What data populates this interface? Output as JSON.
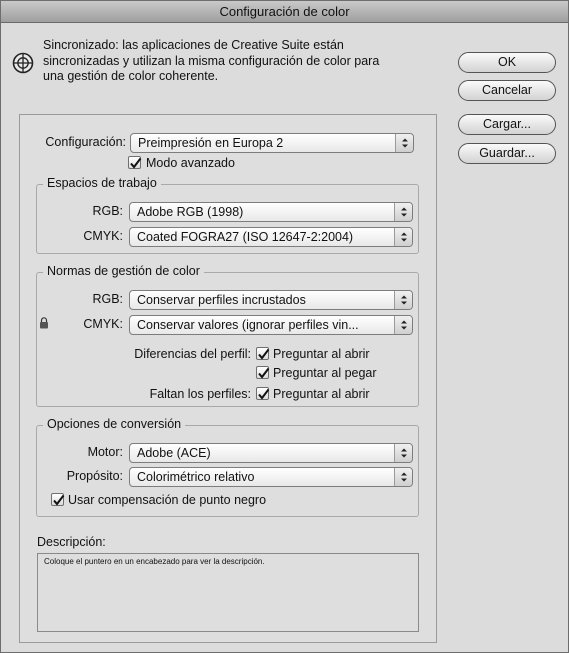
{
  "window": {
    "title": "Configuración de color"
  },
  "sync": {
    "icon": "color-sync-circle-icon",
    "line1": "Sincronizado: las aplicaciones de Creative Suite están",
    "line2": "sincronizadas y utilizan la misma configuración de color para",
    "line3": "una gestión de color coherente."
  },
  "buttons": {
    "ok": "OK",
    "cancel": "Cancelar",
    "load": "Cargar...",
    "save": "Guardar..."
  },
  "settings": {
    "label": "Configuración:",
    "value": "Preimpresión en Europa 2",
    "advanced_mode": {
      "label": "Modo avanzado",
      "checked": true
    }
  },
  "working_spaces": {
    "title": "Espacios de trabajo",
    "rgb_label": "RGB:",
    "rgb_value": "Adobe RGB (1998)",
    "cmyk_label": "CMYK:",
    "cmyk_value": "Coated FOGRA27 (ISO 12647-2:2004)"
  },
  "policies": {
    "title": "Normas de gestión de color",
    "rgb_label": "RGB:",
    "rgb_value": "Conservar perfiles incrustados",
    "cmyk_label": "CMYK:",
    "cmyk_value": "Conservar valores (ignorar perfiles vin...",
    "mismatch_label": "Diferencias del perfil:",
    "ask_open": "Preguntar al abrir",
    "ask_paste": "Preguntar al pegar",
    "missing_label": "Faltan los perfiles:",
    "missing_ask_open": "Preguntar al abrir"
  },
  "conversion": {
    "title": "Opciones de conversión",
    "engine_label": "Motor:",
    "engine_value": "Adobe (ACE)",
    "intent_label": "Propósito:",
    "intent_value": "Colorimétrico relativo",
    "bpc_label": "Usar compensación de punto negro"
  },
  "description": {
    "label": "Descripción:",
    "text": "Coloque el puntero en un encabezado para ver la descripción."
  }
}
